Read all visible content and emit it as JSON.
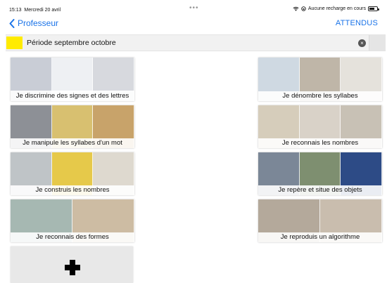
{
  "status_bar": {
    "time": "15:13",
    "date": "Mercredi 20 avril",
    "dots": "•••",
    "charging": "Aucune recharge en cours",
    "icons": [
      "wifi-icon",
      "orientation-lock-icon",
      "battery-icon"
    ]
  },
  "nav": {
    "back_label": "Professeur",
    "right_label": "ATTENDUS",
    "accent": "#1a73e8"
  },
  "period": {
    "title": "Période septembre octobre",
    "swatch_color": "#ffeb00",
    "clear_glyph": "×"
  },
  "cards": {
    "discrimine": {
      "label": "Je discrimine des signes et des lettres",
      "photos": [
        "#c9cdd6",
        "#eef0f3",
        "#d7d9de"
      ]
    },
    "denombre": {
      "label": "Je dénombre les syllabes",
      "photos": [
        "#cfd9e2",
        "#bfb6a8",
        "#e5e2dc"
      ]
    },
    "manipule": {
      "label": "Je manipule les syllabes d'un mot",
      "photos": [
        "#8d9096",
        "#d8c070",
        "#c8a36a"
      ]
    },
    "reconnais_nombres": {
      "label": "Je reconnais les nombres",
      "photos": [
        "#d6cdbb",
        "#d9d2c8",
        "#c8c1b5"
      ]
    },
    "construis": {
      "label": "Je construis les nombres",
      "photos": [
        "#bfc4c7",
        "#e6c94a",
        "#ded9cf"
      ]
    },
    "repere": {
      "label": "Je repère et situe des objets",
      "photos": [
        "#7b8797",
        "#7e8f70",
        "#2d4b86"
      ]
    },
    "formes": {
      "label": "Je reconnais des formes",
      "photos": [
        "#a6b8b2",
        "#cdbca3"
      ]
    },
    "algorithme": {
      "label": "Je reproduis un algorithme",
      "photos": [
        "#b4a99b",
        "#c9bdae"
      ]
    }
  },
  "add_card": {
    "icon": "plus-icon"
  }
}
